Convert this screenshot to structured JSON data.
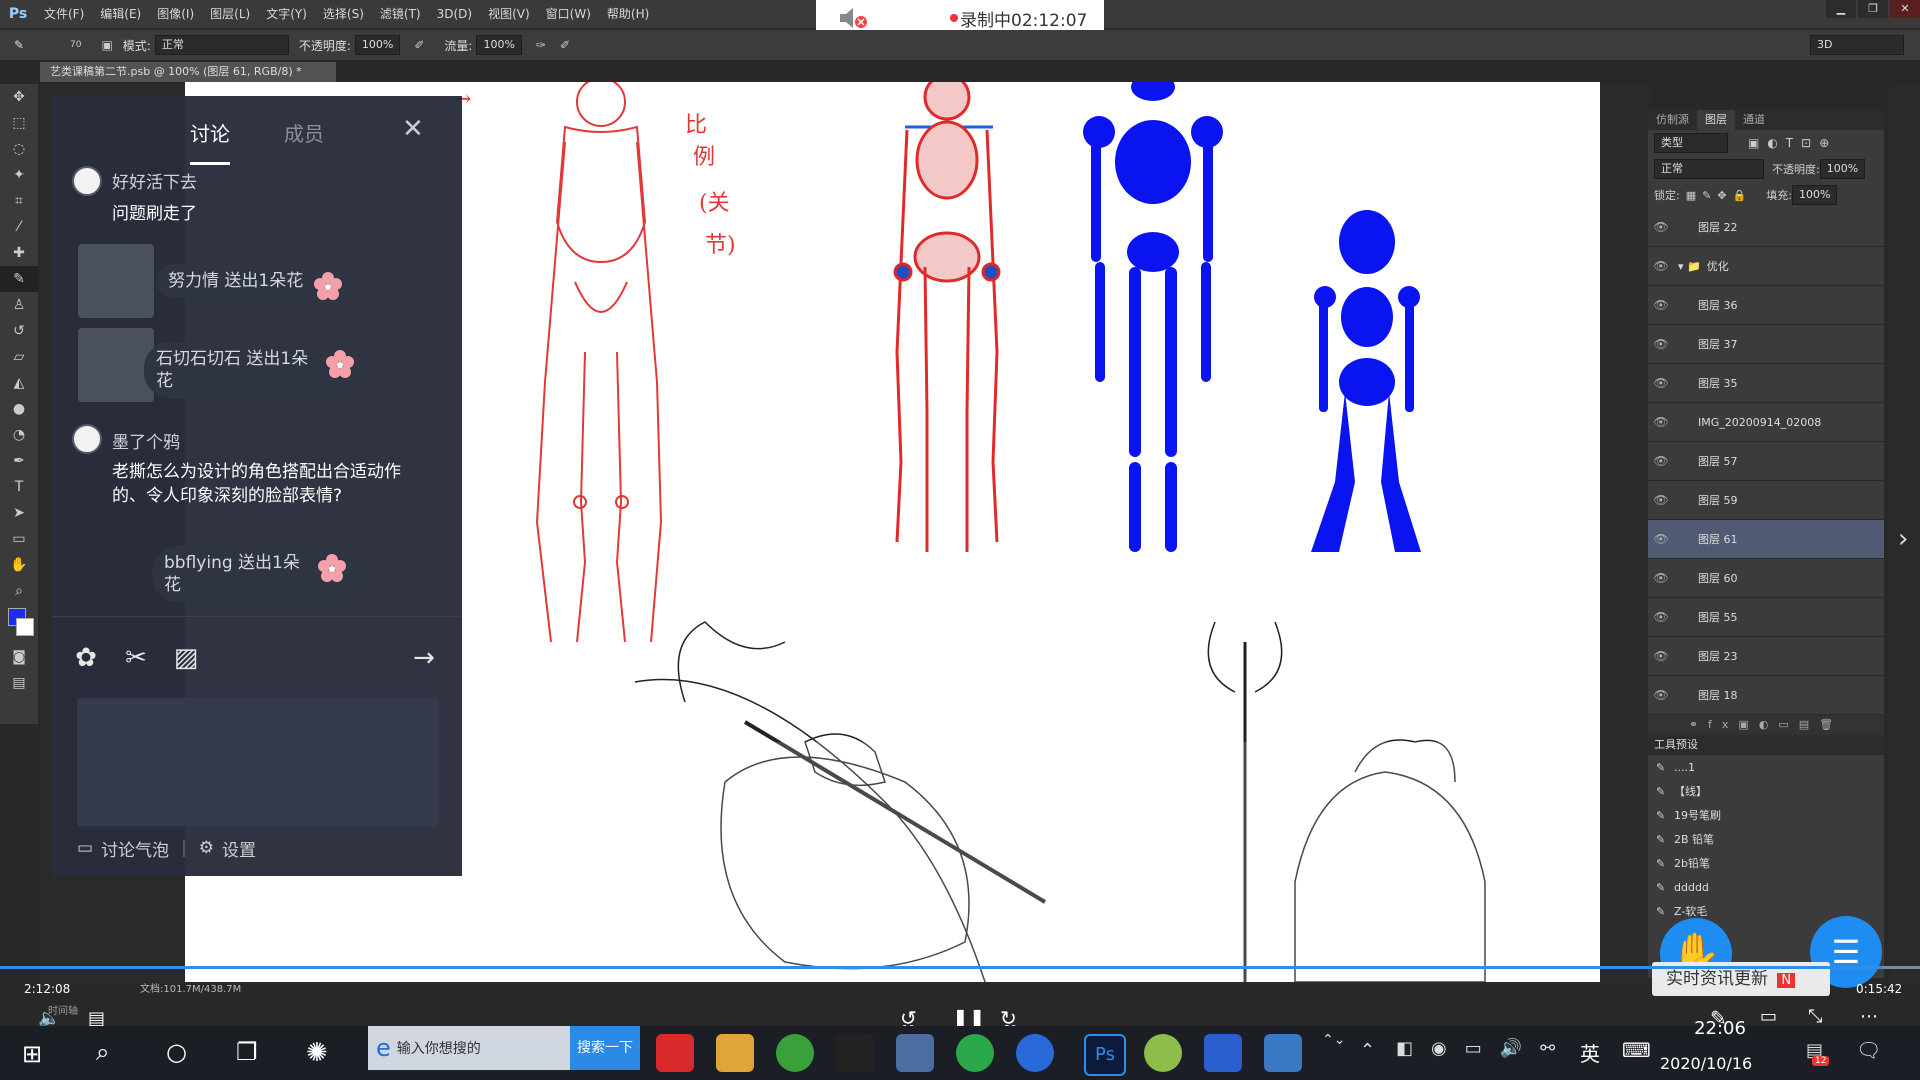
{
  "app": {
    "logo": "Ps",
    "menus": [
      "文件(F)",
      "编辑(E)",
      "图像(I)",
      "图层(L)",
      "文字(Y)",
      "选择(S)",
      "滤镜(T)",
      "3D(D)",
      "视图(V)",
      "窗口(W)",
      "帮助(H)"
    ],
    "workspace": "3D"
  },
  "recording": {
    "text": "录制中02:12:07"
  },
  "options": {
    "brush_size": "70",
    "mode_label": "模式:",
    "mode_value": "正常",
    "opacity_label": "不透明度:",
    "opacity_value": "100%",
    "flow_label": "流量:",
    "flow_value": "100%"
  },
  "document": {
    "tab": "艺类课稿第二节.psb @ 100% (图层 61, RGB/8) *"
  },
  "canvas_labels": {
    "ratio_a": "比",
    "ratio_b": "例",
    "ratio_c": "(关",
    "ratio_d": "节)"
  },
  "chat": {
    "tabs": {
      "discuss": "讨论",
      "members": "成员"
    },
    "messages": [
      {
        "user": "好好活下去",
        "text": "问题刷走了"
      },
      {
        "gift": "努力情 送出1朵花"
      },
      {
        "gift": "石切石切石 送出1朵花"
      },
      {
        "user": "墨了个鸦",
        "text": "老撕怎么为设计的角色搭配出合适动作的、令人印象深刻的脸部表情?"
      },
      {
        "gift": "bbflying 送出1朵花"
      }
    ],
    "footer": {
      "bubble": "讨论气泡",
      "settings": "设置"
    }
  },
  "layers_panel": {
    "tabs": [
      "仿制源",
      "图层",
      "通道"
    ],
    "filter": "类型",
    "blend": "正常",
    "opacity_label": "不透明度:",
    "opacity": "100%",
    "lock_label": "锁定:",
    "fill_label": "填充:",
    "fill": "100%",
    "layers": [
      {
        "name": "图层 22",
        "selected": false
      },
      {
        "name": "优化",
        "selected": false,
        "group": true
      },
      {
        "name": "图层 36",
        "selected": false
      },
      {
        "name": "图层 37",
        "selected": false
      },
      {
        "name": "图层 35",
        "selected": false
      },
      {
        "name": "IMG_20200914_02008",
        "selected": false
      },
      {
        "name": "图层 57",
        "selected": false
      },
      {
        "name": "图层 59",
        "selected": false
      },
      {
        "name": "图层 61",
        "selected": true
      },
      {
        "name": "图层 60",
        "selected": false
      },
      {
        "name": "图层 55",
        "selected": false
      },
      {
        "name": "图层 23",
        "selected": false
      },
      {
        "name": "图层 18",
        "selected": false
      }
    ]
  },
  "presets_panel": {
    "title": "工具预设",
    "items": [
      "....1",
      "【线】",
      "19号笔刷",
      "2B 铅笔",
      "2b铅笔",
      "ddddd",
      "Z-软毛"
    ]
  },
  "status": {
    "zoom": "2:12:08%",
    "doc": "文档:101.7M/438.7M",
    "timeline": "时间轴"
  },
  "player": {
    "elapsed": "2:12:08",
    "total": "0:15:42",
    "progress": 0.98,
    "skip_back": "10",
    "skip_fwd": "30"
  },
  "news": {
    "text": "实时资讯更新",
    "badge": "N"
  },
  "taskbar": {
    "search_placeholder": "输入你想搜的",
    "search_button": "搜索一下",
    "ime": "英",
    "time": "22:06",
    "date": "2020/10/16",
    "notify_count": "12"
  }
}
